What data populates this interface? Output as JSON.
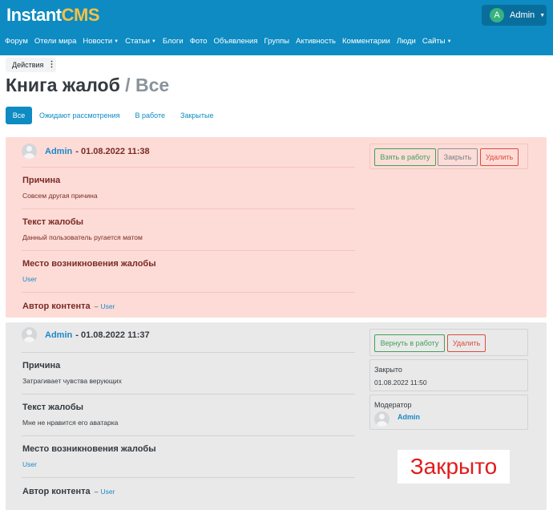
{
  "header": {
    "logo_main": "Instant",
    "logo_accent": "CMS",
    "user": {
      "initial": "A",
      "name": "Admin"
    },
    "nav": [
      {
        "label": "Форум",
        "dropdown": false
      },
      {
        "label": "Отели мира",
        "dropdown": false
      },
      {
        "label": "Новости",
        "dropdown": true
      },
      {
        "label": "Статьи",
        "dropdown": true
      },
      {
        "label": "Блоги",
        "dropdown": false
      },
      {
        "label": "Фото",
        "dropdown": false
      },
      {
        "label": "Объявления",
        "dropdown": false
      },
      {
        "label": "Группы",
        "dropdown": false
      },
      {
        "label": "Активность",
        "dropdown": false
      },
      {
        "label": "Комментарии",
        "dropdown": false
      },
      {
        "label": "Люди",
        "dropdown": false
      },
      {
        "label": "Сайты",
        "dropdown": true
      }
    ]
  },
  "actions_label": "Действия",
  "title": {
    "main": "Книга жалоб",
    "separator": "/",
    "sub": "Все"
  },
  "tabs": [
    "Все",
    "Ожидают рассмотрения",
    "В работе",
    "Закрытые"
  ],
  "complaints": [
    {
      "author": "Admin",
      "date": "- 01.08.2022 11:38",
      "reason_title": "Причина",
      "reason": "Совсем другая причина",
      "text_title": "Текст жалобы",
      "text": "Данный пользователь ругается матом",
      "place_title": "Место возникновения жалобы",
      "place_link": "User",
      "content_author_title": "Автор контента",
      "content_author_sep": "–",
      "content_author_link": "User",
      "buttons": [
        "Взять в работу",
        "Закрыть",
        "Удалить"
      ]
    },
    {
      "author": "Admin",
      "date": "- 01.08.2022 11:37",
      "reason_title": "Причина",
      "reason": "Затрагивает чувства верующих",
      "text_title": "Текст жалобы",
      "text": "Мне не нравится его аватарка",
      "place_title": "Место возникновения жалобы",
      "place_link": "User",
      "content_author_title": "Автор контента",
      "content_author_sep": "–",
      "content_author_link": "User",
      "buttons": [
        "Вернуть в работу",
        "Удалить"
      ],
      "closed_label": "Закрыто",
      "closed_date": "01.08.2022 11:50",
      "moderator_label": "Модератор",
      "moderator_name": "Admin"
    }
  ],
  "status_stamp": "Закрыто",
  "colors": {
    "header_bg": "#0d8bc2",
    "logo_accent": "#f6c244",
    "open_card_bg": "#fddcd7",
    "closed_card_bg": "#e9e9e9",
    "link": "#1e88c7",
    "button_green": "#3fa15a",
    "button_red": "#e04b3c",
    "stamp_text": "#e21b1b"
  }
}
